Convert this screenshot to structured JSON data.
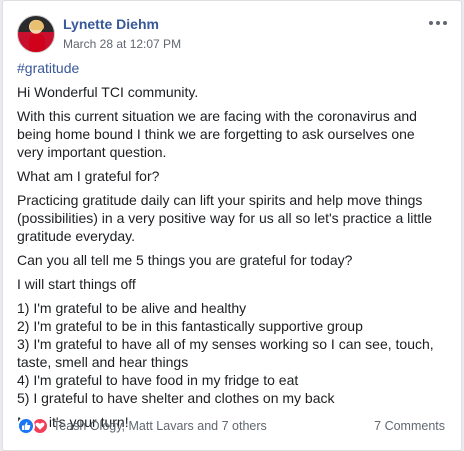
{
  "post": {
    "author": "Lynette Diehm",
    "timestamp": "March 28 at 12:07 PM",
    "hashtag": "#gratitude",
    "paragraphs": [
      "Hi Wonderful TCI community.",
      "With this current situation we are facing with the coronavirus and being home bound I think we are forgetting to ask ourselves one very important question.",
      "What am I grateful for?",
      "Practicing gratitude daily can lift your spirits and help move things (possibilities) in a very positive way for us all so let's practice a little gratitude everyday.",
      "Can you all tell me 5 things you are grateful for today?",
      "I will start things off"
    ],
    "list": [
      "1) I'm grateful to be alive and healthy",
      "2) I'm grateful to be in this fantastically supportive group",
      "3) I'm grateful to have all of my senses working so I can see, touch, taste, smell and hear things",
      "4) I'm grateful to have food in my fridge to eat",
      "5) I grateful to have shelter and clothes on my back"
    ],
    "closing": "Now it's your turn!"
  },
  "footer": {
    "reactors": "Teash Ology, Matt Lavars and 7 others",
    "comments": "7 Comments"
  },
  "icons": {
    "more": "more-options-icon",
    "like": "like-reaction-icon",
    "love": "love-reaction-icon"
  },
  "colors": {
    "link": "#385898",
    "like": "#1877f2",
    "love": "#f33e58"
  }
}
